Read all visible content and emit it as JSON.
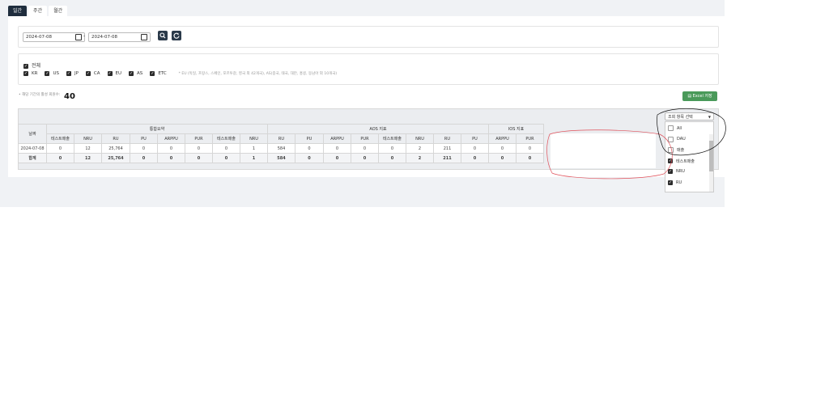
{
  "tabs": [
    "일간",
    "주간",
    "월간"
  ],
  "date_filter": {
    "start": "2024-07-08",
    "end": "2024-07-08",
    "separator": "-",
    "search_icon": "search-icon",
    "refresh_icon": "refresh-icon"
  },
  "regions": {
    "all_label": "전체",
    "items": [
      "KR",
      "US",
      "JP",
      "CA",
      "EU",
      "AS",
      "ETC"
    ],
    "note": "* EU (독일, 프랑스, 스페인, 포르투갈, 영국 외 42개국), AS(중국, 태국, 대만, 홍콩, 동남아 외 10개국)"
  },
  "summary": {
    "label": "• 해당 기간의 활성 회원수:",
    "value": "40"
  },
  "excel_button": "Excel 저장",
  "column_selector": {
    "placeholder": "조회 항목 선택",
    "options": [
      {
        "label": "All",
        "checked": false
      },
      {
        "label": "DAU",
        "checked": false
      },
      {
        "label": "매출",
        "checked": false
      },
      {
        "label": "테스트매출",
        "checked": true
      },
      {
        "label": "NRU",
        "checked": true
      },
      {
        "label": "RU",
        "checked": true
      }
    ]
  },
  "table": {
    "date_header": "날짜",
    "group_headers": [
      "통합요약",
      "AOS 지표",
      "IOS 지표"
    ],
    "sub_headers": [
      "테스트매출",
      "NRU",
      "RU",
      "PU",
      "ARPPU",
      "PUR",
      "테스트매출",
      "NRU",
      "RU",
      "PU",
      "ARPPU",
      "PUR",
      "테스트매출",
      "NRU",
      "RU",
      "PU",
      "ARPPU",
      "PUR"
    ],
    "rows": [
      [
        "2024-07-08",
        "0",
        "12",
        "25,764",
        "0",
        "0",
        "0",
        "0",
        "1",
        "584",
        "0",
        "0",
        "0",
        "0",
        "2",
        "211",
        "0",
        "0",
        "0"
      ],
      [
        "합계",
        "0",
        "12",
        "25,764",
        "0",
        "0",
        "0",
        "0",
        "1",
        "584",
        "0",
        "0",
        "0",
        "0",
        "2",
        "211",
        "0",
        "0",
        "0"
      ]
    ]
  }
}
